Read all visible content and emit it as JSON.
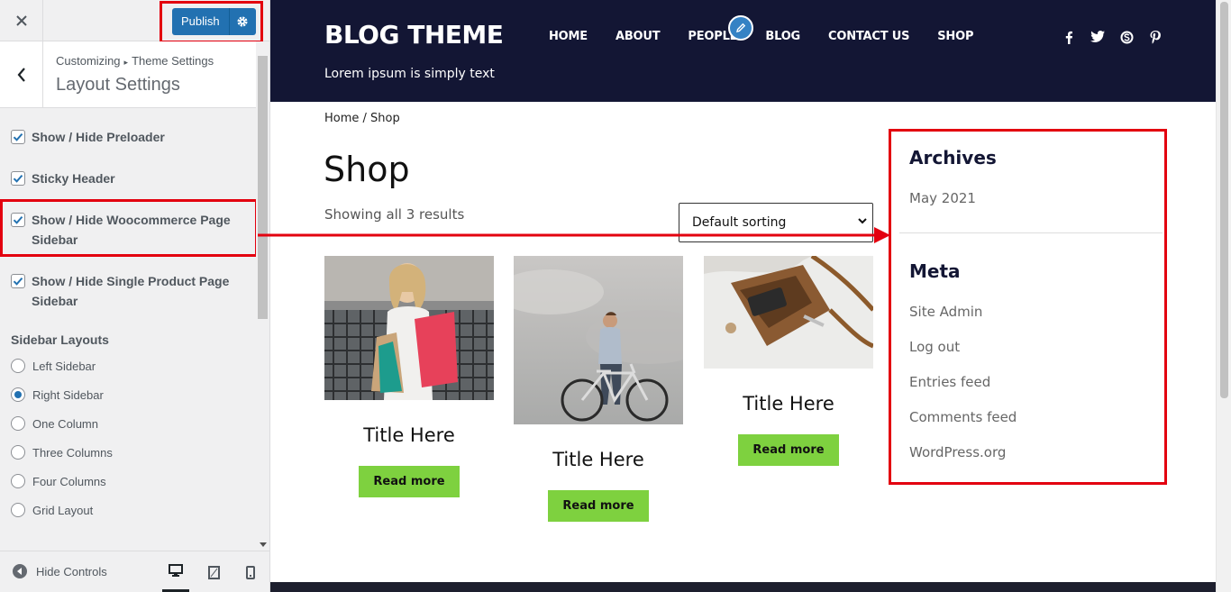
{
  "customizer": {
    "close_icon": "close-icon",
    "publish_label": "Publish",
    "breadcrumb_root": "Customizing",
    "breadcrumb_sep": "▸",
    "breadcrumb_section": "Theme Settings",
    "panel_title": "Layout Settings",
    "checkboxes": [
      {
        "label": "Show / Hide Preloader",
        "checked": true
      },
      {
        "label": "Sticky Header",
        "checked": true
      },
      {
        "label": "Show / Hide Woocommerce Page Sidebar",
        "checked": true
      },
      {
        "label": "Show / Hide Single Product Page Sidebar",
        "checked": true
      }
    ],
    "sidebar_layouts_title": "Sidebar Layouts",
    "radio_options": [
      {
        "label": "Left Sidebar",
        "selected": false
      },
      {
        "label": "Right Sidebar",
        "selected": true
      },
      {
        "label": "One Column",
        "selected": false
      },
      {
        "label": "Three Columns",
        "selected": false
      },
      {
        "label": "Four Columns",
        "selected": false
      },
      {
        "label": "Grid Layout",
        "selected": false
      }
    ],
    "footer": {
      "hide_controls_label": "Hide Controls",
      "devices": [
        "desktop",
        "tablet",
        "mobile"
      ],
      "active_device": "desktop"
    },
    "accent_color": "#2271b1"
  },
  "site": {
    "title": "BLOG THEME",
    "tagline": "Lorem ipsum is simply text",
    "nav": [
      "HOME",
      "ABOUT",
      "PEOPLE",
      "BLOG",
      "CONTACT US",
      "SHOP"
    ],
    "social": [
      "facebook-icon",
      "twitter-icon",
      "skype-icon",
      "pinterest-icon"
    ],
    "header_color": "#131634",
    "breadcrumb_home": "Home",
    "breadcrumb_sep": " / ",
    "breadcrumb_current": "Shop",
    "page_title": "Shop",
    "result_count": "Showing all 3 results",
    "sort_selected": "Default sorting",
    "products": [
      {
        "title": "Title Here",
        "button": "Read more"
      },
      {
        "title": "Title Here",
        "button": "Read more"
      },
      {
        "title": "Title Here",
        "button": "Read more"
      }
    ],
    "button_color": "#7ed13f",
    "widgets": {
      "archives_title": "Archives",
      "archives": [
        "May 2021"
      ],
      "meta_title": "Meta",
      "meta_links": [
        "Site Admin",
        "Log out",
        "Entries feed",
        "Comments feed",
        "WordPress.org"
      ]
    }
  },
  "annotation_color": "#e3000f"
}
